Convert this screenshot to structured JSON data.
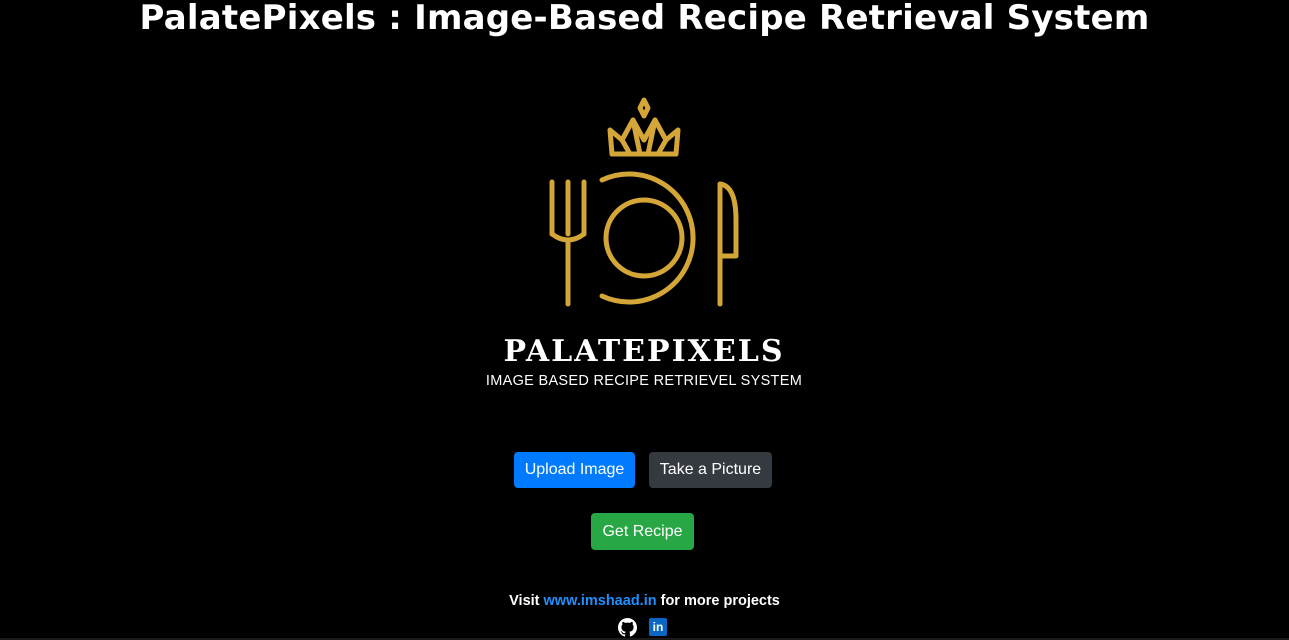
{
  "header": {
    "title": "PalatePixels : Image-Based Recipe Retrieval System"
  },
  "logo": {
    "brand_name": "PALATEPIXELS",
    "tagline": "IMAGE BASED RECIPE RETRIEVEL SYSTEM",
    "icon": "crown-plate-fork-knife-logo",
    "accent_color": "#D4A537"
  },
  "actions": {
    "upload_label": "Upload Image",
    "camera_label": "Take a Picture",
    "get_recipe_label": "Get Recipe"
  },
  "colors": {
    "primary": "#007bff",
    "dark": "#343a40",
    "success": "#28a745",
    "background": "#000000",
    "link": "#1e90ff"
  },
  "footer": {
    "prefix": "Visit ",
    "link_text": "www.imshaad.in",
    "suffix": " for more projects",
    "icons": [
      "github-icon",
      "linkedin-icon"
    ],
    "linkedin_glyph": "in"
  }
}
